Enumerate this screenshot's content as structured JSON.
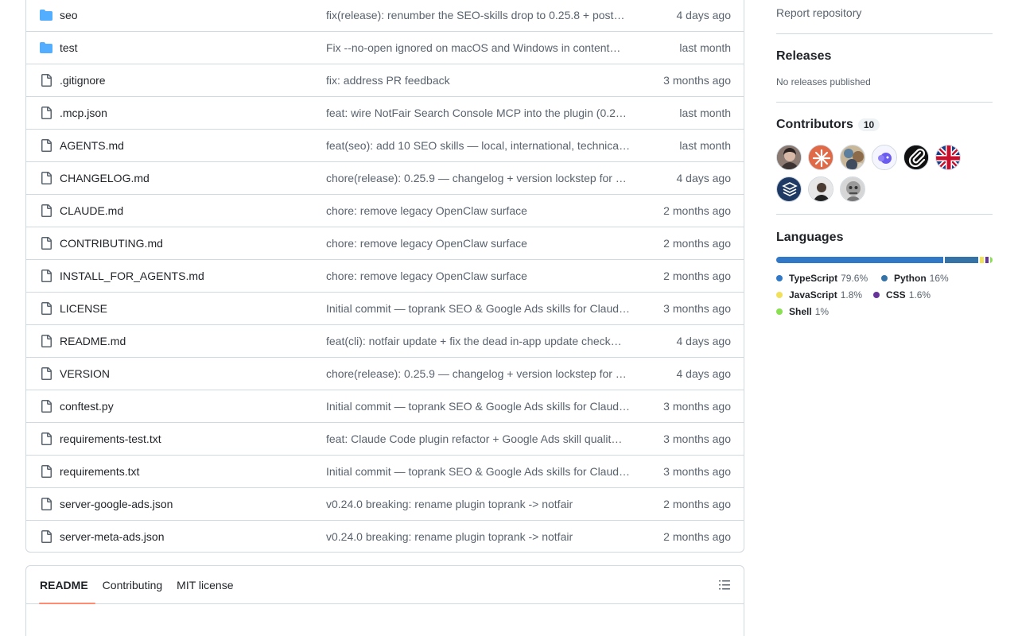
{
  "files": [
    {
      "name": "seo",
      "type": "folder",
      "message": "fix(release): renumber the SEO-skills drop to 0.25.8 + post…",
      "date": "4 days ago"
    },
    {
      "name": "test",
      "type": "folder",
      "message": "Fix --no-open ignored on macOS and Windows in content…",
      "date": "last month"
    },
    {
      "name": ".gitignore",
      "type": "file",
      "message": "fix: address PR feedback",
      "date": "3 months ago"
    },
    {
      "name": ".mcp.json",
      "type": "file",
      "message": "feat: wire NotFair Search Console MCP into the plugin (0.2…",
      "date": "last month"
    },
    {
      "name": "AGENTS.md",
      "type": "file",
      "message": "feat(seo): add 10 SEO skills — local, international, technica…",
      "date": "last month"
    },
    {
      "name": "CHANGELOG.md",
      "type": "file",
      "message": "chore(release): 0.25.9 — changelog + version lockstep for …",
      "date": "4 days ago"
    },
    {
      "name": "CLAUDE.md",
      "type": "file",
      "message": "chore: remove legacy OpenClaw surface",
      "date": "2 months ago"
    },
    {
      "name": "CONTRIBUTING.md",
      "type": "file",
      "message": "chore: remove legacy OpenClaw surface",
      "date": "2 months ago"
    },
    {
      "name": "INSTALL_FOR_AGENTS.md",
      "type": "file",
      "message": "chore: remove legacy OpenClaw surface",
      "date": "2 months ago"
    },
    {
      "name": "LICENSE",
      "type": "file",
      "message": "Initial commit — toprank SEO & Google Ads skills for Claud…",
      "date": "3 months ago"
    },
    {
      "name": "README.md",
      "type": "file",
      "message": "feat(cli): notfair update + fix the dead in-app update check…",
      "date": "4 days ago"
    },
    {
      "name": "VERSION",
      "type": "file",
      "message": "chore(release): 0.25.9 — changelog + version lockstep for …",
      "date": "4 days ago"
    },
    {
      "name": "conftest.py",
      "type": "file",
      "message": "Initial commit — toprank SEO & Google Ads skills for Claud…",
      "date": "3 months ago"
    },
    {
      "name": "requirements-test.txt",
      "type": "file",
      "message": "feat: Claude Code plugin refactor + Google Ads skill qualit…",
      "date": "3 months ago"
    },
    {
      "name": "requirements.txt",
      "type": "file",
      "message": "Initial commit — toprank SEO & Google Ads skills for Claud…",
      "date": "3 months ago"
    },
    {
      "name": "server-google-ads.json",
      "type": "file",
      "message": "v0.24.0 breaking: rename plugin toprank -> notfair",
      "date": "2 months ago"
    },
    {
      "name": "server-meta-ads.json",
      "type": "file",
      "message": "v0.24.0 breaking: rename plugin toprank -> notfair",
      "date": "2 months ago"
    }
  ],
  "readme": {
    "tabs": [
      "README",
      "Contributing",
      "MIT license"
    ],
    "active_tab": "README"
  },
  "sidebar": {
    "report_link": "Report repository",
    "releases_title": "Releases",
    "releases_empty": "No releases published",
    "contributors_title": "Contributors",
    "contributors_count": "10",
    "languages_title": "Languages",
    "languages": [
      {
        "name": "TypeScript",
        "percent": "79.6%",
        "value": 79.6,
        "color": "#3178c6"
      },
      {
        "name": "Python",
        "percent": "16%",
        "value": 16,
        "color": "#3572A5"
      },
      {
        "name": "JavaScript",
        "percent": "1.8%",
        "value": 1.8,
        "color": "#f1e05a"
      },
      {
        "name": "CSS",
        "percent": "1.6%",
        "value": 1.6,
        "color": "#663399"
      },
      {
        "name": "Shell",
        "percent": "1%",
        "value": 1,
        "color": "#89e051"
      }
    ]
  },
  "colors": {
    "folder": "#54aeff",
    "tab_underline": "#fd8c73",
    "border": "#d1d9e0",
    "muted": "#59636e"
  }
}
